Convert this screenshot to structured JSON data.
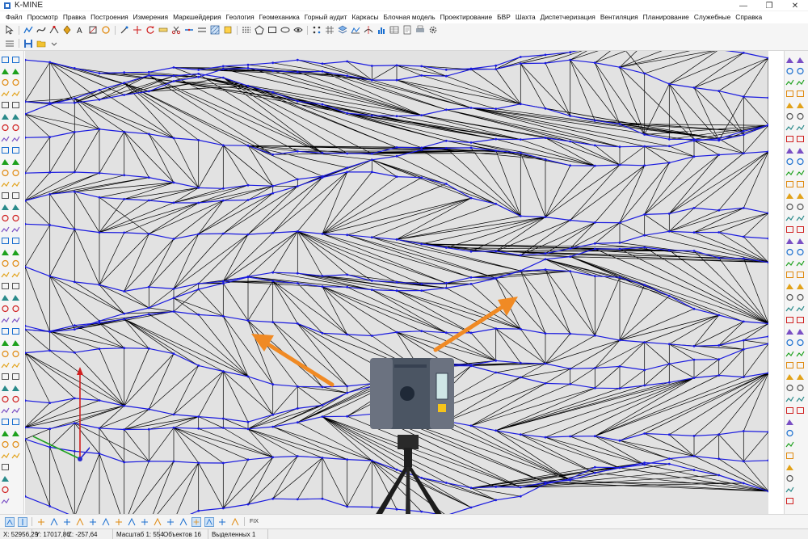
{
  "window": {
    "title": "K-MINE",
    "minimize": "—",
    "maximize": "❐",
    "close": "✕"
  },
  "menu": [
    "Файл",
    "Просмотр",
    "Правка",
    "Построения",
    "Измерения",
    "Маркшейдерия",
    "Геология",
    "Геомеханика",
    "Горный аудит",
    "Каркасы",
    "Блочная модель",
    "Проектирование",
    "БВР",
    "Шахта",
    "Диспетчеризация",
    "Вентиляция",
    "Планирование",
    "Служебные",
    "Справка"
  ],
  "status": {
    "x": "X: 52956,29",
    "y": "Y: 17017,86",
    "z": "Z: -257,64",
    "scale": "Масштаб 1: 554",
    "objects": "Объектов 16",
    "selected": "Выделенных 1"
  },
  "bottom_toolbar": {
    "fix_label": "FIX"
  },
  "colors": {
    "viewport_bg": "#e2e2e2",
    "mesh_edge": "#000000",
    "contour": "#1a1adf",
    "vertex": "#1a1adf",
    "arrow": "#f08a24",
    "axis_x": "#1ea11e",
    "axis_y": "#d02020",
    "axis_z": "#2a2acc"
  },
  "icons": {
    "toolbar1": [
      "cursor-icon",
      "polyline-icon",
      "curve-icon",
      "node-icon",
      "point-icon",
      "text-icon",
      "frame-icon",
      "circle-icon",
      "edit-node-icon",
      "move-icon",
      "rotate-icon",
      "measure-icon",
      "cut-icon",
      "join-icon",
      "offset-icon",
      "hatch-icon",
      "block-icon",
      "line-style-icon",
      "polygon-icon",
      "rectangle-icon",
      "ellipse-icon",
      "eye-icon",
      "snap-icon",
      "grid-icon",
      "layers-icon",
      "surface-icon",
      "section-icon",
      "chart-icon",
      "table-icon",
      "report-icon",
      "print-icon",
      "settings-icon"
    ],
    "toolbar2": [
      "list-icon",
      "save-icon",
      "open-folder-icon"
    ]
  }
}
